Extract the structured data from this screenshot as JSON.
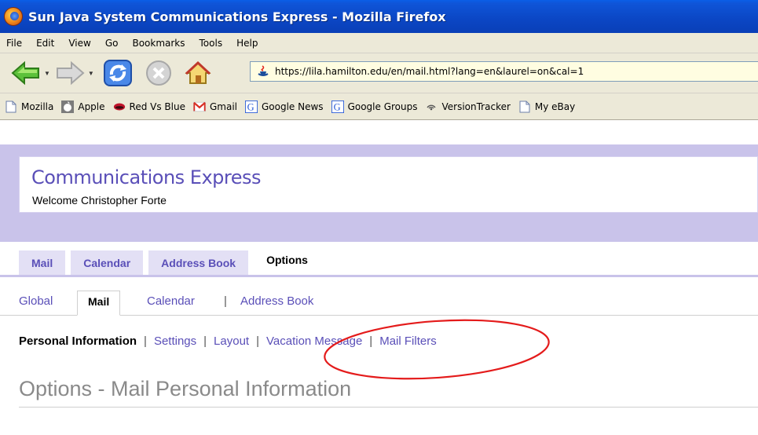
{
  "window": {
    "title": "Sun Java System Communications Express - Mozilla Firefox"
  },
  "menubar": {
    "items": [
      "File",
      "Edit",
      "View",
      "Go",
      "Bookmarks",
      "Tools",
      "Help"
    ]
  },
  "navigation": {
    "url": "https://lila.hamilton.edu/en/mail.html?lang=en&laurel=on&cal=1"
  },
  "bookmarks": {
    "items": [
      {
        "label": "Mozilla",
        "icon": "page-icon"
      },
      {
        "label": "Apple",
        "icon": "apple-icon"
      },
      {
        "label": "Red Vs Blue",
        "icon": "red-vs-blue-icon"
      },
      {
        "label": "Gmail",
        "icon": "gmail-icon"
      },
      {
        "label": "Google News",
        "icon": "google-icon"
      },
      {
        "label": "Google Groups",
        "icon": "google-icon"
      },
      {
        "label": "VersionTracker",
        "icon": "feed-icon"
      },
      {
        "label": "My eBay",
        "icon": "page-icon"
      }
    ]
  },
  "app": {
    "title": "Communications Express",
    "welcome": "Welcome Christopher Forte",
    "accent_color": "#5a4fb8",
    "banner_color": "#c9c3ea"
  },
  "main_tabs": [
    "Mail",
    "Calendar",
    "Address Book",
    "Options"
  ],
  "sub_tabs": {
    "global": "Global",
    "mail": "Mail",
    "calendar": "Calendar",
    "separator": "|",
    "address_book": "Address Book"
  },
  "options_links": {
    "personal_information": "Personal Information",
    "settings": "Settings",
    "layout": "Layout",
    "vacation_message": "Vacation Message",
    "mail_filters": "Mail Filters",
    "separator": "|"
  },
  "page": {
    "heading": "Options - Mail Personal Information"
  },
  "annotation": {
    "color": "#e41b1b"
  }
}
